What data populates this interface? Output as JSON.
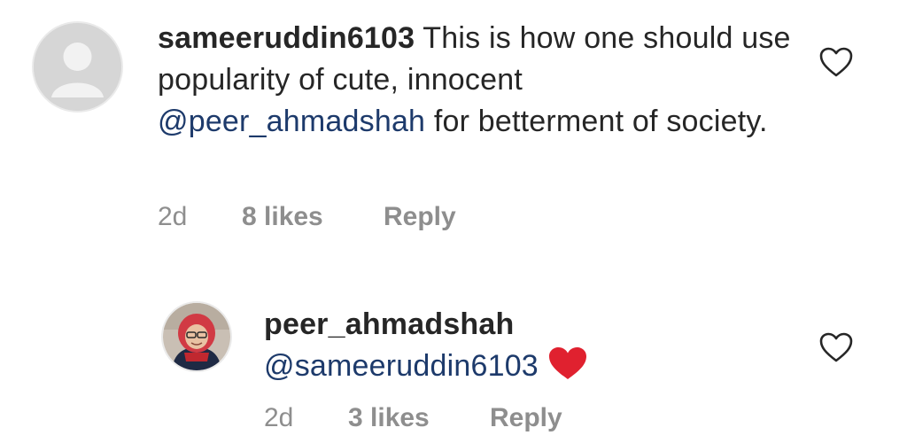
{
  "comments": [
    {
      "username": "sameeruddin6103",
      "text_before": " This is how one should use popularity of cute, innocent ",
      "mention": "@peer_ahmadshah",
      "text_after": " for betterment of society.",
      "time": "2d",
      "likes": "8 likes",
      "reply": "Reply",
      "avatar_icon": "default-avatar-icon"
    },
    {
      "username": "peer_ahmadshah",
      "mention": "@sameeruddin6103",
      "emoji": "red-heart",
      "time": "2d",
      "likes": "3 likes",
      "reply": "Reply",
      "avatar_icon": "profile-photo"
    }
  ],
  "colors": {
    "mention": "#1d3a6b",
    "meta": "#8e8e8e",
    "heart_emoji": "#e0212f"
  }
}
